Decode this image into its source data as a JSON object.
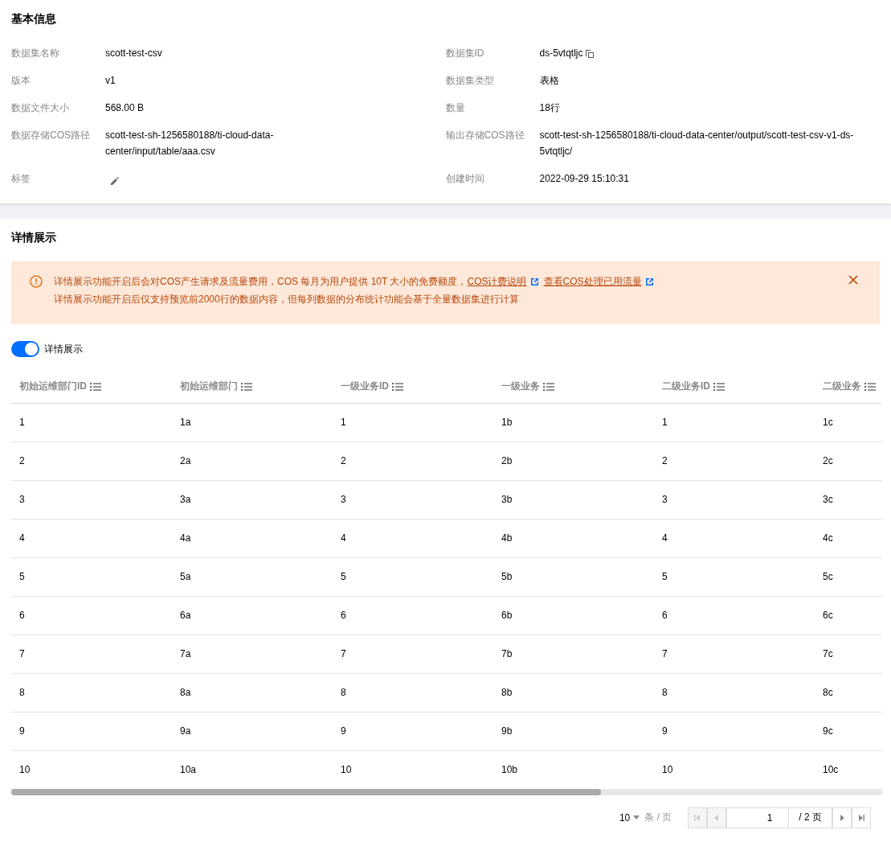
{
  "basic_info": {
    "title": "基本信息",
    "left": [
      {
        "label": "数据集名称",
        "value": "scott-test-csv"
      },
      {
        "label": "版本",
        "value": "v1"
      },
      {
        "label": "数据文件大小",
        "value": "568.00 B"
      },
      {
        "label": "数据存储COS路径",
        "value": "scott-test-sh-1256580188/ti-cloud-data-center/input/table/aaa.csv"
      },
      {
        "label": "标签",
        "kind": "edit"
      }
    ],
    "right": [
      {
        "label": "数据集ID",
        "value": "ds-5vtqtljc",
        "kind": "copy"
      },
      {
        "label": "数据集类型",
        "value": "表格"
      },
      {
        "label": "数量",
        "value": "18行"
      },
      {
        "label": "输出存储COS路径",
        "value": "scott-test-sh-1256580188/ti-cloud-data-center/output/scott-test-csv-v1-ds-5vtqtljc/"
      },
      {
        "label": "创建时间",
        "value": "2022-09-29 15:10:31"
      }
    ]
  },
  "details": {
    "title": "详情展示",
    "alert": {
      "line1": "详情展示功能开启后会对COS产生请求及流量费用，COS 每月为用户提供 10T 大小的免费额度，",
      "links": [
        "COS计费说明",
        "查看COS处理已用流量"
      ],
      "line2": "详情展示功能开启后仅支持预览前2000行的数据内容，但每列数据的分布统计功能会基于全量数据集进行计算"
    },
    "toggle": {
      "label": "详情展示",
      "on": true
    },
    "table": {
      "columns": [
        "初始运维部门ID",
        "初始运维部门",
        "一级业务ID",
        "一级业务",
        "二级业务ID",
        "二级业务"
      ],
      "rows": [
        [
          "1",
          "1a",
          "1",
          "1b",
          "1",
          "1c"
        ],
        [
          "2",
          "2a",
          "2",
          "2b",
          "2",
          "2c"
        ],
        [
          "3",
          "3a",
          "3",
          "3b",
          "3",
          "3c"
        ],
        [
          "4",
          "4a",
          "4",
          "4b",
          "4",
          "4c"
        ],
        [
          "5",
          "5a",
          "5",
          "5b",
          "5",
          "5c"
        ],
        [
          "6",
          "6a",
          "6",
          "6b",
          "6",
          "6c"
        ],
        [
          "7",
          "7a",
          "7",
          "7b",
          "7",
          "7c"
        ],
        [
          "8",
          "8a",
          "8",
          "8b",
          "8",
          "8c"
        ],
        [
          "9",
          "9a",
          "9",
          "9b",
          "9",
          "9c"
        ],
        [
          "10",
          "10a",
          "10",
          "10b",
          "10",
          "10c"
        ]
      ]
    },
    "pagination": {
      "page_size": "10",
      "per_page_label": "条 / 页",
      "page": "1",
      "total_label": "/ 2 页",
      "first_disabled": true,
      "prev_disabled": true,
      "next_disabled": false,
      "last_disabled": false
    }
  }
}
